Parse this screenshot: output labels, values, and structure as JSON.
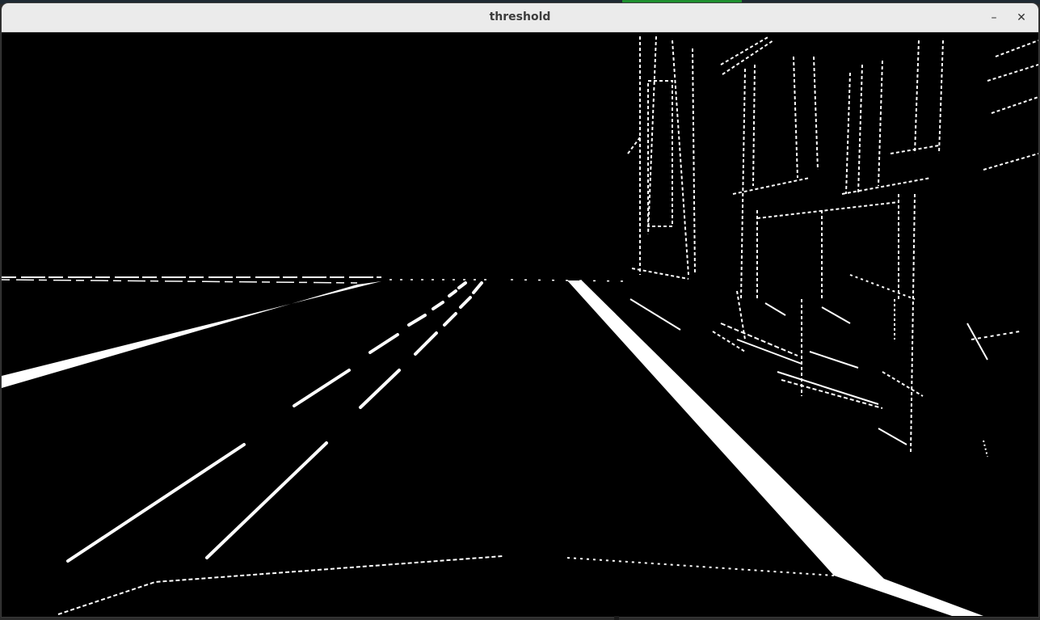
{
  "window": {
    "title": "threshold",
    "minimize_icon": "minimize-icon",
    "close_icon": "close-icon",
    "minimize_glyph": "–",
    "close_glyph": "✕"
  },
  "image": {
    "description_type": "binary-threshold-road-scene",
    "foreground_color": "#ffffff",
    "background_color": "#000000"
  }
}
